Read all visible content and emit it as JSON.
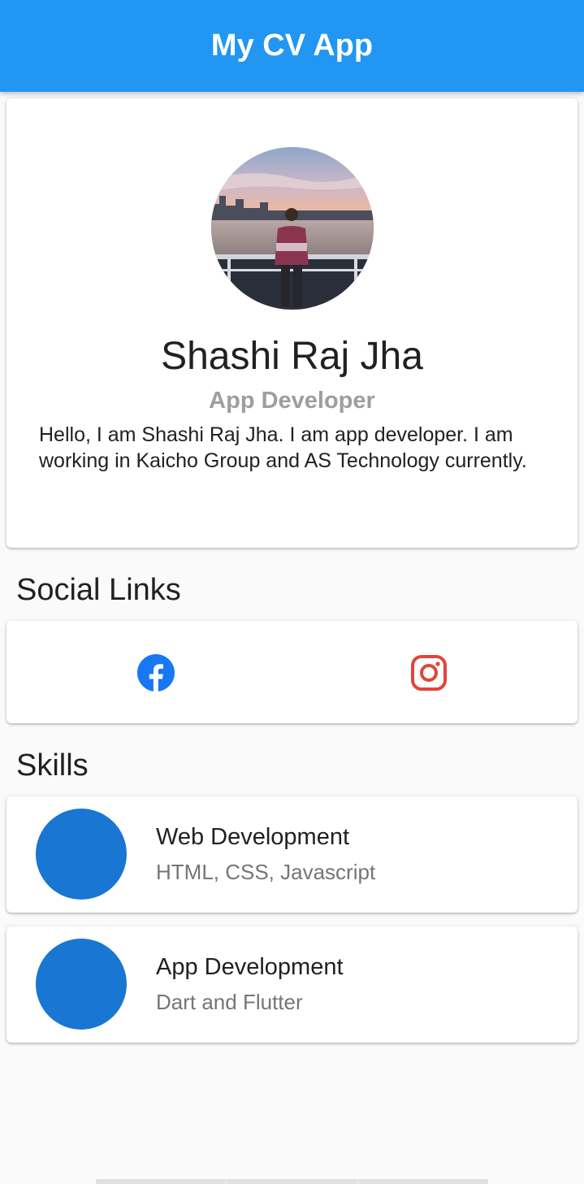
{
  "app_bar": {
    "title": "My CV App",
    "color": "#2196f3"
  },
  "profile": {
    "avatar_icon": "profile-photo",
    "name": "Shashi Raj Jha",
    "role": "App Developer",
    "bio": "Hello, I am Shashi Raj Jha. I am app developer. I am working in Kaicho Group and AS Technology currently."
  },
  "social": {
    "title": "Social Links",
    "links": [
      {
        "icon": "facebook-icon",
        "color": "#1877f2"
      },
      {
        "icon": "instagram-icon",
        "color": "#e0453b"
      }
    ]
  },
  "skills": {
    "title": "Skills",
    "items": [
      {
        "title": "Web Development",
        "subtitle": "HTML, CSS, Javascript",
        "color": "#1976d2"
      },
      {
        "title": "App Development",
        "subtitle": "Dart and Flutter",
        "color": "#1976d2"
      }
    ]
  }
}
